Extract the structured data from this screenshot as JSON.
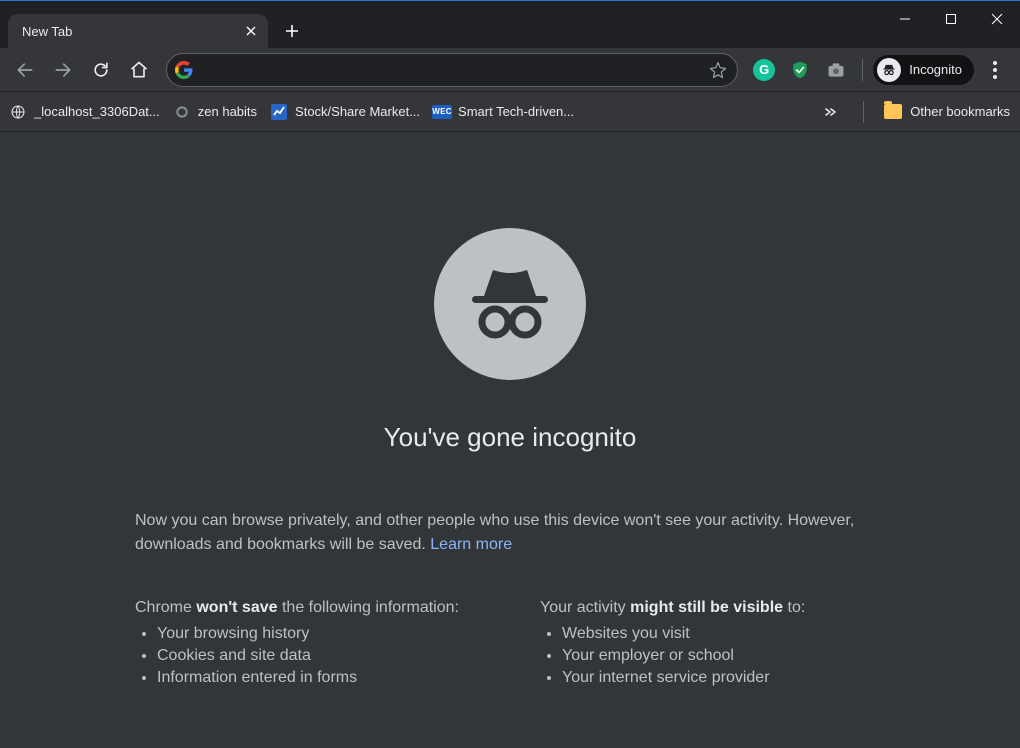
{
  "window": {
    "tab_title": "New Tab"
  },
  "toolbar": {
    "address_value": "",
    "incognito_label": "Incognito"
  },
  "extensions": [
    {
      "id": "grammarly-icon",
      "bg": "#15c39a",
      "letter": "G"
    },
    {
      "id": "shield-icon",
      "bg": "transparent",
      "letter": ""
    },
    {
      "id": "camera-icon",
      "bg": "transparent",
      "letter": ""
    }
  ],
  "bookmarks": [
    {
      "id": "bookmark-localhost",
      "icon": "globe",
      "label": "_localhost_3306Dat..."
    },
    {
      "id": "bookmark-zen",
      "icon": "ring",
      "label": "zen habits"
    },
    {
      "id": "bookmark-stock",
      "icon": "chart",
      "label": "Stock/Share Market..."
    },
    {
      "id": "bookmark-smart",
      "icon": "wec",
      "label": "Smart Tech-driven..."
    }
  ],
  "other_bookmarks_label": "Other bookmarks",
  "page": {
    "headline": "You've gone incognito",
    "description_pre": "Now you can browse privately, and other people who use this device won't see your activity. However, downloads and bookmarks will be saved. ",
    "learn_more": "Learn more",
    "left": {
      "pre": "Chrome ",
      "bold": "won't save",
      "post": " the following information:",
      "items": [
        "Your browsing history",
        "Cookies and site data",
        "Information entered in forms"
      ]
    },
    "right": {
      "pre": "Your activity ",
      "bold": "might still be visible",
      "post": " to:",
      "items": [
        "Websites you visit",
        "Your employer or school",
        "Your internet service provider"
      ]
    }
  }
}
